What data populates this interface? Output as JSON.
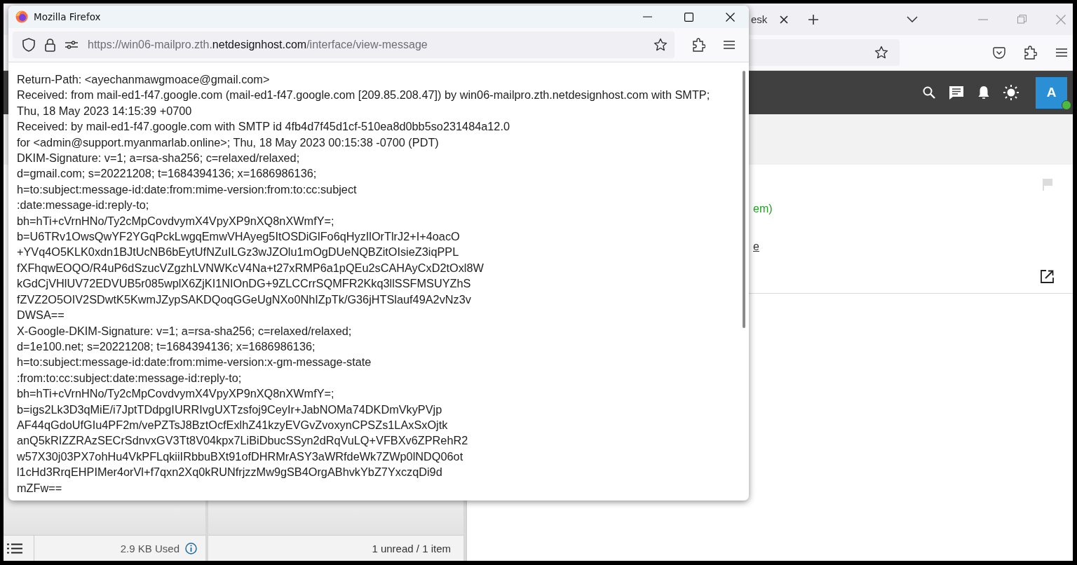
{
  "background_browser": {
    "tab": {
      "label": "esk"
    },
    "app_header": {
      "avatar": "A",
      "online": true
    },
    "message": {
      "fragments": [
        {
          "kind": "status",
          "text": "em)"
        },
        {
          "kind": "link",
          "text": "e"
        }
      ]
    },
    "footer": {
      "storage": "2.9 KB Used",
      "count": "1 unread / 1 item"
    }
  },
  "popup": {
    "title": "Mozilla Firefox",
    "url": {
      "prefix": "https://win06-mailpro.zth.",
      "domain": "netdesignhost.com",
      "path": "/interface/view-message"
    },
    "lines": [
      "Return-Path: <ayechanmawgmoace@gmail.com>",
      "Received: from mail-ed1-f47.google.com (mail-ed1-f47.google.com [209.85.208.47]) by win06-mailpro.zth.netdesignhost.com with SMTP;",
      "Thu, 18 May 2023 14:15:39 +0700",
      "Received: by mail-ed1-f47.google.com with SMTP id 4fb4d7f45d1cf-510ea8d0bb5so231484a12.0",
      "for <admin@support.myanmarlab.online>; Thu, 18 May 2023 00:15:38 -0700 (PDT)",
      "DKIM-Signature: v=1; a=rsa-sha256; c=relaxed/relaxed;",
      "d=gmail.com; s=20221208; t=1684394136; x=1686986136;",
      "h=to:subject:message-id:date:from:mime-version:from:to:cc:subject",
      ":date:message-id:reply-to;",
      "bh=hTi+cVrnHNo/Ty2cMpCovdvymX4VpyXP9nXQ8nXWmfY=;",
      "b=U6TRv1OwsQwYF2YGqPckLwgqEmwVHAyeg5ItOSDiGlFo6qHyzIlOrTlrJ2+I+4oacO",
      "+YVq4O5KLK0xdn1BJtUcNB6bEytUfNZuILGz3wJZOlu1mOgDUeNQBZitOIsieZ3iqPPL",
      "fXFhqwEOQO/R4uP6dSzucVZgzhLVNWKcV4Na+t27xRMP6a1pQEu2sCAHAyCxD2tOxl8W",
      "kGdCjVHlUV72EDVUB5r085wplX6ZjKI1NIOnDG+9ZLCCrrSQMFR2Kkq3llSSFMSUYZhS",
      "fZVZ2O5OIV2SDwtK5KwmJZypSAKDQoqGGeUgNXo0NhIZpTk/G36jHTSlauf49A2vNz3v",
      "DWSA==",
      "X-Google-DKIM-Signature: v=1; a=rsa-sha256; c=relaxed/relaxed;",
      "d=1e100.net; s=20221208; t=1684394136; x=1686986136;",
      "h=to:subject:message-id:date:from:mime-version:x-gm-message-state",
      ":from:to:cc:subject:date:message-id:reply-to;",
      "bh=hTi+cVrnHNo/Ty2cMpCovdvymX4VpyXP9nXQ8nXWmfY=;",
      "b=igs2Lk3D3qMiE/i7JptTDdpgIURRIvgUXTzsfoj9CeyIr+JabNOMa74DKDmVkyPVjp",
      "AF44qGdoUfGIu4PF2m/vePZTsJ8BztOcfExlhZ41kzyEVGvZvoxynCPSZs1LAxSxOjtk",
      "anQ5kRIZZRAzSECrSdnvxGV3Tt8V04kpx7LiBiDbucSSyn2dRqVuLQ+VFBXv6ZPRehR2",
      "w57X30j03PX7ohHu4VkPFLqkiiIRbbuBXt91ofDHRMrASY3aWRfdeWk7ZWp0lNDQ06ot",
      "l1cHd3RrqEHPIMer4orVl+f7qxn2Xq0kRUNfrjzzMw9gSB4OrgABhvkYbZ7YxczqDi9d",
      "mZFw=="
    ]
  }
}
